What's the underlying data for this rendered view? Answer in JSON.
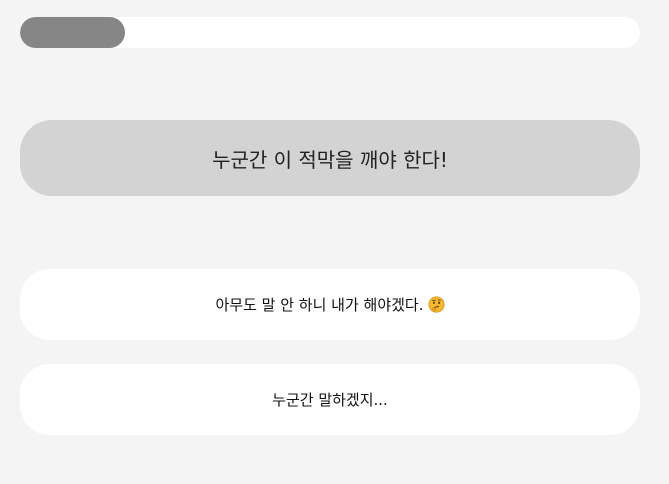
{
  "progress": {
    "fraction": 0.17
  },
  "question": {
    "text": "누군간 이 적막을 깨야 한다!"
  },
  "options": [
    {
      "text": "아무도 말 안 하니 내가 해야겠다.",
      "icon": "thinking-face-icon"
    },
    {
      "text": "누군간 말하겠지..."
    }
  ],
  "colors": {
    "background": "#f4f4f4",
    "progress_fill": "#868686",
    "question_card": "#d3d3d3",
    "option_card": "#ffffff"
  }
}
